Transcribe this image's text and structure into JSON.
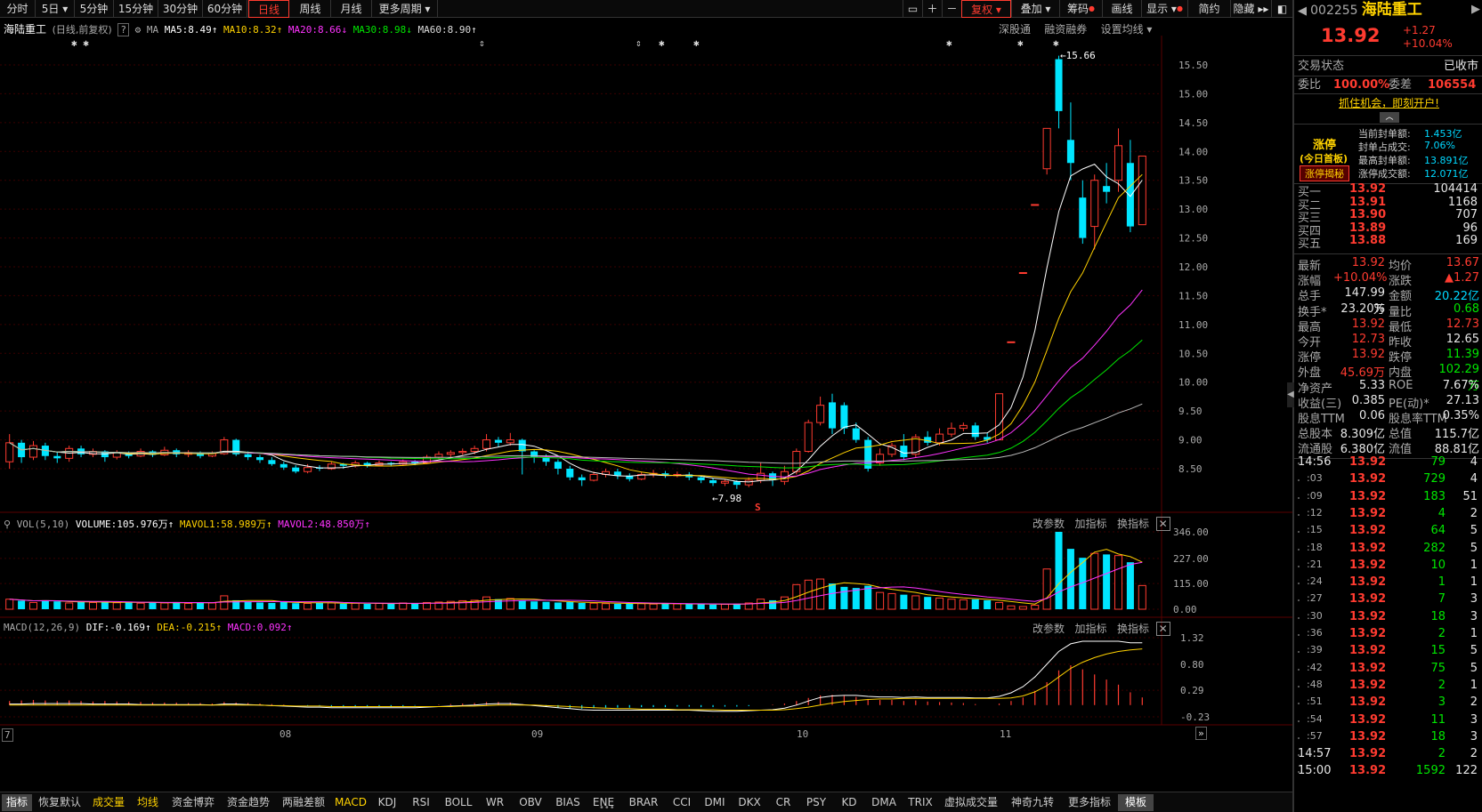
{
  "toolbar": {
    "periods": [
      "分时",
      "5日",
      "5分钟",
      "15分钟",
      "30分钟",
      "60分钟",
      "日线",
      "周线",
      "月线",
      "更多周期"
    ],
    "active_period": "日线",
    "tools": [
      "复权",
      "叠加",
      "筹码",
      "画线",
      "显示",
      "简约",
      "隐藏"
    ]
  },
  "stock": {
    "name": "海陆重工",
    "code": "002255",
    "mode": "(日线,前复权)",
    "price": "13.92",
    "change": "+1.27",
    "change_pct": "+10.04%"
  },
  "ma_legend": {
    "label": "MA",
    "ma5": "MA5:8.49",
    "ma10": "MA10:8.32",
    "ma20": "MA20:8.66",
    "ma30": "MA30:8.98",
    "ma60": "MA60:8.90"
  },
  "chart_links": [
    "深股通",
    "融资融券",
    "设置均线"
  ],
  "price_axis": [
    "15.50",
    "15.00",
    "14.50",
    "14.00",
    "13.50",
    "13.00",
    "12.50",
    "12.00",
    "11.50",
    "11.00",
    "10.50",
    "10.00",
    "9.50",
    "9.00",
    "8.50"
  ],
  "annotations": {
    "high": "15.66",
    "low": "7.98",
    "marker": "S"
  },
  "vol_legend": {
    "label": "VOL(5,10)",
    "volume": "VOLUME:105.976万",
    "mavol1": "MAVOL1:58.989万",
    "mavol2": "MAVOL2:48.850万"
  },
  "vol_axis": [
    "346.00",
    "227.00",
    "115.00",
    "0.00"
  ],
  "panel_links": [
    "改参数",
    "加指标",
    "换指标"
  ],
  "macd_legend": {
    "label": "MACD(12,26,9)",
    "dif": "DIF:-0.169",
    "dea": "DEA:-0.215",
    "macd": "MACD:0.092"
  },
  "macd_axis": [
    "1.32",
    "0.80",
    "0.29",
    "-0.23"
  ],
  "x_axis": [
    "7",
    "08",
    "09",
    "10",
    "11"
  ],
  "tabs": [
    "指标",
    "恢复默认",
    "成交量",
    "均线",
    "资金博弈",
    "资金趋势",
    "两融差额",
    "MACD",
    "KDJ",
    "RSI",
    "BOLL",
    "WR",
    "OBV",
    "BIAS",
    "ENE",
    "BRAR",
    "CCI",
    "DMI",
    "DKX",
    "CR",
    "PSY",
    "KD",
    "DMA",
    "TRIX",
    "虚拟成交量",
    "神奇九转",
    "更多指标",
    "模板"
  ],
  "panel": {
    "status_label": "交易状态",
    "status_value": "已收市",
    "webi_label": "委比",
    "webi_value": "100.00%",
    "wecha_label": "委差",
    "wecha_value": "106554",
    "promo": "抓住机会，即刻开户!",
    "limit_title": "涨停",
    "limit_sub": "(今日首板)",
    "limit_btn": "涨停揭秘",
    "limit_stats": [
      {
        "label": "当前封单额:",
        "value": "1.453亿"
      },
      {
        "label": "封单占成交:",
        "value": "7.06%"
      },
      {
        "label": "最高封单额:",
        "value": "13.891亿"
      },
      {
        "label": "涨停成交额:",
        "value": "12.071亿"
      }
    ],
    "bids": [
      {
        "label": "买一",
        "price": "13.92",
        "vol": "104414"
      },
      {
        "label": "买二",
        "price": "13.91",
        "vol": "1168"
      },
      {
        "label": "买三",
        "price": "13.90",
        "vol": "707"
      },
      {
        "label": "买四",
        "price": "13.89",
        "vol": "96"
      },
      {
        "label": "买五",
        "price": "13.88",
        "vol": "169"
      }
    ],
    "stats": [
      {
        "l1": "最新",
        "v1": "13.92",
        "c1": "red",
        "l2": "均价",
        "v2": "13.67",
        "c2": "red"
      },
      {
        "l1": "涨幅",
        "v1": "+10.04%",
        "c1": "red",
        "l2": "涨跌",
        "v2": "▲1.27",
        "c2": "red"
      },
      {
        "l1": "总手",
        "v1": "147.99万",
        "c1": "white",
        "l2": "金额",
        "v2": "20.22亿",
        "c2": "cyan"
      },
      {
        "l1": "换手*",
        "v1": "23.20%",
        "c1": "white",
        "l2": "量比",
        "v2": "0.68",
        "c2": "green"
      },
      {
        "l1": "最高",
        "v1": "13.92",
        "c1": "red",
        "l2": "最低",
        "v2": "12.73",
        "c2": "red"
      },
      {
        "l1": "今开",
        "v1": "12.73",
        "c1": "red",
        "l2": "昨收",
        "v2": "12.65",
        "c2": "white"
      },
      {
        "l1": "涨停",
        "v1": "13.92",
        "c1": "red",
        "l2": "跌停",
        "v2": "11.39",
        "c2": "green"
      },
      {
        "l1": "外盘",
        "v1": "45.69万",
        "c1": "red",
        "l2": "内盘",
        "v2": "102.29万",
        "c2": "green"
      },
      {
        "l1": "净资产",
        "v1": "5.33",
        "c1": "white",
        "l2": "ROE",
        "v2": "7.67%",
        "c2": "white"
      },
      {
        "l1": "收益(三)",
        "v1": "0.385",
        "c1": "white",
        "l2": "PE(动)*",
        "v2": "27.13",
        "c2": "white"
      },
      {
        "l1": "股息TTM",
        "v1": "0.06",
        "c1": "white",
        "l2": "股息率TTM",
        "v2": "0.35%",
        "c2": "white"
      },
      {
        "l1": "总股本",
        "v1": "8.309亿",
        "c1": "white",
        "l2": "总值",
        "v2": "115.7亿",
        "c2": "white"
      },
      {
        "l1": "流通股",
        "v1": "6.380亿",
        "c1": "white",
        "l2": "流值",
        "v2": "88.81亿",
        "c2": "white"
      }
    ],
    "ticks": [
      {
        "t": "14:56",
        "p": "13.92",
        "v": "79",
        "n": "4"
      },
      {
        "t": ":03",
        "p": "13.92",
        "v": "729",
        "n": "4"
      },
      {
        "t": ":09",
        "p": "13.92",
        "v": "183",
        "n": "51"
      },
      {
        "t": ":12",
        "p": "13.92",
        "v": "4",
        "n": "2"
      },
      {
        "t": ":15",
        "p": "13.92",
        "v": "64",
        "n": "5"
      },
      {
        "t": ":18",
        "p": "13.92",
        "v": "282",
        "n": "5"
      },
      {
        "t": ":21",
        "p": "13.92",
        "v": "10",
        "n": "1"
      },
      {
        "t": ":24",
        "p": "13.92",
        "v": "1",
        "n": "1"
      },
      {
        "t": ":27",
        "p": "13.92",
        "v": "7",
        "n": "3"
      },
      {
        "t": ":30",
        "p": "13.92",
        "v": "18",
        "n": "3"
      },
      {
        "t": ":36",
        "p": "13.92",
        "v": "2",
        "n": "1"
      },
      {
        "t": ":39",
        "p": "13.92",
        "v": "15",
        "n": "5"
      },
      {
        "t": ":42",
        "p": "13.92",
        "v": "75",
        "n": "5"
      },
      {
        "t": ":48",
        "p": "13.92",
        "v": "2",
        "n": "1"
      },
      {
        "t": ":51",
        "p": "13.92",
        "v": "3",
        "n": "2"
      },
      {
        "t": ":54",
        "p": "13.92",
        "v": "11",
        "n": "3"
      },
      {
        "t": ":57",
        "p": "13.92",
        "v": "18",
        "n": "3"
      },
      {
        "t": "14:57",
        "p": "13.92",
        "v": "2",
        "n": "2"
      },
      {
        "t": "15:00",
        "p": "13.92",
        "v": "1592",
        "n": "122"
      }
    ]
  },
  "chart_data": {
    "type": "candlestick",
    "price_range": [
      8.2,
      15.66
    ],
    "candles": [
      [
        8.62,
        8.95,
        9.1,
        8.5
      ],
      [
        8.95,
        8.7,
        9.0,
        8.6
      ],
      [
        8.7,
        8.9,
        8.98,
        8.65
      ],
      [
        8.9,
        8.72,
        8.95,
        8.65
      ],
      [
        8.72,
        8.68,
        8.8,
        8.6
      ],
      [
        8.68,
        8.85,
        8.9,
        8.62
      ],
      [
        8.85,
        8.75,
        8.9,
        8.7
      ],
      [
        8.75,
        8.8,
        8.85,
        8.7
      ],
      [
        8.8,
        8.7,
        8.82,
        8.62
      ],
      [
        8.7,
        8.78,
        8.82,
        8.66
      ],
      [
        8.78,
        8.72,
        8.8,
        8.68
      ],
      [
        8.72,
        8.8,
        8.85,
        8.7
      ],
      [
        8.8,
        8.74,
        8.82,
        8.7
      ],
      [
        8.74,
        8.82,
        8.88,
        8.72
      ],
      [
        8.82,
        8.75,
        8.85,
        8.7
      ],
      [
        8.75,
        8.78,
        8.82,
        8.7
      ],
      [
        8.78,
        8.72,
        8.8,
        8.68
      ],
      [
        8.72,
        8.76,
        8.8,
        8.7
      ],
      [
        8.76,
        9.0,
        9.05,
        8.74
      ],
      [
        9.0,
        8.75,
        9.02,
        8.72
      ],
      [
        8.75,
        8.7,
        8.8,
        8.65
      ],
      [
        8.7,
        8.65,
        8.74,
        8.6
      ],
      [
        8.65,
        8.58,
        8.7,
        8.55
      ],
      [
        8.58,
        8.52,
        8.62,
        8.48
      ],
      [
        8.52,
        8.45,
        8.56,
        8.42
      ],
      [
        8.45,
        8.52,
        8.58,
        8.42
      ],
      [
        8.52,
        8.5,
        8.56,
        8.46
      ],
      [
        8.5,
        8.58,
        8.62,
        8.48
      ],
      [
        8.58,
        8.55,
        8.6,
        8.5
      ],
      [
        8.55,
        8.6,
        8.64,
        8.52
      ],
      [
        8.6,
        8.56,
        8.62,
        8.52
      ],
      [
        8.56,
        8.6,
        8.64,
        8.54
      ],
      [
        8.6,
        8.58,
        8.62,
        8.54
      ],
      [
        8.58,
        8.62,
        8.66,
        8.55
      ],
      [
        8.62,
        8.6,
        8.65,
        8.56
      ],
      [
        8.6,
        8.7,
        8.74,
        8.58
      ],
      [
        8.7,
        8.75,
        8.8,
        8.66
      ],
      [
        8.75,
        8.78,
        8.82,
        8.7
      ],
      [
        8.78,
        8.8,
        8.85,
        8.74
      ],
      [
        8.8,
        8.85,
        8.9,
        8.75
      ],
      [
        8.85,
        9.0,
        9.1,
        8.8
      ],
      [
        9.0,
        8.95,
        9.05,
        8.88
      ],
      [
        8.95,
        9.0,
        9.12,
        8.9
      ],
      [
        9.0,
        8.8,
        9.02,
        8.4
      ],
      [
        8.8,
        8.7,
        8.82,
        8.6
      ],
      [
        8.7,
        8.62,
        8.75,
        8.55
      ],
      [
        8.62,
        8.5,
        8.66,
        8.4
      ],
      [
        8.5,
        8.35,
        8.55,
        8.3
      ],
      [
        8.35,
        8.3,
        8.4,
        8.2
      ],
      [
        8.3,
        8.4,
        8.45,
        8.28
      ],
      [
        8.4,
        8.45,
        8.5,
        8.35
      ],
      [
        8.45,
        8.38,
        8.5,
        8.32
      ],
      [
        8.38,
        8.32,
        8.42,
        8.28
      ],
      [
        8.32,
        8.4,
        8.45,
        8.3
      ],
      [
        8.4,
        8.42,
        8.48,
        8.35
      ],
      [
        8.42,
        8.38,
        8.46,
        8.34
      ],
      [
        8.38,
        8.4,
        8.45,
        8.35
      ],
      [
        8.4,
        8.35,
        8.44,
        8.3
      ],
      [
        8.35,
        8.3,
        8.38,
        8.25
      ],
      [
        8.3,
        8.25,
        8.34,
        8.2
      ],
      [
        8.25,
        8.28,
        8.32,
        8.2
      ],
      [
        8.28,
        8.22,
        8.3,
        8.15
      ],
      [
        8.22,
        8.3,
        8.35,
        8.18
      ],
      [
        8.3,
        8.42,
        8.6,
        8.25
      ],
      [
        8.42,
        8.3,
        8.45,
        8.2
      ],
      [
        8.28,
        8.45,
        8.55,
        8.22
      ],
      [
        8.45,
        8.8,
        8.85,
        8.4
      ],
      [
        8.8,
        9.3,
        9.35,
        8.78
      ],
      [
        9.3,
        9.6,
        9.75,
        9.25
      ],
      [
        9.65,
        9.2,
        9.8,
        9.1
      ],
      [
        9.6,
        9.2,
        9.65,
        9.1
      ],
      [
        9.2,
        9.0,
        9.3,
        8.95
      ],
      [
        9.0,
        8.5,
        9.05,
        8.45
      ],
      [
        8.6,
        8.75,
        8.85,
        8.55
      ],
      [
        8.75,
        8.9,
        8.95,
        8.7
      ],
      [
        8.9,
        8.7,
        9.1,
        8.65
      ],
      [
        8.75,
        9.05,
        9.1,
        8.7
      ],
      [
        9.05,
        8.95,
        9.15,
        8.9
      ],
      [
        8.95,
        9.1,
        9.2,
        8.9
      ],
      [
        9.1,
        9.2,
        9.3,
        9.05
      ],
      [
        9.2,
        9.25,
        9.3,
        9.15
      ],
      [
        9.25,
        9.05,
        9.3,
        9.0
      ],
      [
        9.05,
        9.0,
        9.12,
        8.95
      ],
      [
        9.0,
        9.8,
        9.8,
        9.0
      ],
      [
        10.7,
        10.7,
        10.7,
        10.7
      ],
      [
        11.9,
        11.9,
        11.9,
        11.9
      ],
      [
        13.08,
        13.08,
        13.08,
        13.08
      ],
      [
        13.7,
        14.4,
        14.4,
        13.6
      ],
      [
        15.6,
        14.7,
        15.66,
        14.4
      ],
      [
        14.2,
        13.8,
        14.85,
        13.5
      ],
      [
        13.2,
        12.5,
        13.5,
        12.4
      ],
      [
        12.7,
        13.5,
        13.6,
        12.3
      ],
      [
        13.4,
        13.3,
        13.8,
        13.1
      ],
      [
        13.5,
        14.1,
        14.4,
        13.3
      ],
      [
        13.8,
        12.7,
        14.2,
        12.6
      ],
      [
        12.73,
        13.92,
        13.92,
        12.73
      ]
    ],
    "volume_range": [
      0,
      346
    ],
    "volumes": [
      45,
      38,
      30,
      40,
      35,
      28,
      32,
      30,
      34,
      29,
      31,
      27,
      30,
      28,
      32,
      26,
      30,
      28,
      60,
      40,
      35,
      30,
      28,
      32,
      27,
      26,
      30,
      28,
      25,
      27,
      24,
      26,
      25,
      28,
      24,
      30,
      32,
      35,
      38,
      40,
      55,
      45,
      48,
      40,
      35,
      33,
      30,
      32,
      28,
      27,
      25,
      24,
      26,
      25,
      23,
      25,
      24,
      23,
      22,
      21,
      22,
      24,
      28,
      45,
      40,
      55,
      110,
      130,
      135,
      115,
      100,
      95,
      105,
      75,
      70,
      65,
      60,
      55,
      50,
      45,
      42,
      44,
      40,
      30,
      15,
      12,
      18,
      180,
      346,
      270,
      230,
      250,
      245,
      240,
      210,
      106
    ],
    "macd_range": [
      -0.23,
      1.32
    ],
    "macd_hist": [
      0.08,
      0.09,
      0.1,
      0.09,
      0.08,
      0.09,
      0.08,
      0.07,
      0.08,
      0.07,
      0.06,
      0.06,
      0.05,
      0.05,
      0.05,
      0.04,
      0.04,
      0.03,
      0.06,
      0.05,
      0.04,
      0.03,
      0.02,
      0.01,
      0.0,
      -0.01,
      -0.01,
      -0.02,
      -0.02,
      -0.02,
      -0.02,
      -0.02,
      -0.02,
      -0.02,
      -0.01,
      0.0,
      0.01,
      0.02,
      0.03,
      0.04,
      0.06,
      0.06,
      0.05,
      0.02,
      -0.01,
      -0.03,
      -0.05,
      -0.06,
      -0.07,
      -0.06,
      -0.05,
      -0.05,
      -0.05,
      -0.04,
      -0.04,
      -0.04,
      -0.03,
      -0.03,
      -0.04,
      -0.04,
      -0.03,
      -0.03,
      -0.02,
      0.0,
      0.01,
      0.03,
      0.08,
      0.14,
      0.19,
      0.2,
      0.18,
      0.16,
      0.12,
      0.1,
      0.1,
      0.08,
      0.09,
      0.07,
      0.06,
      0.05,
      0.04,
      0.02,
      0.0,
      0.03,
      0.08,
      0.15,
      0.28,
      0.45,
      0.68,
      0.78,
      0.7,
      0.6,
      0.5,
      0.4,
      0.25,
      0.15
    ],
    "dif": [
      0.02,
      0.02,
      0.03,
      0.03,
      0.03,
      0.03,
      0.03,
      0.02,
      0.02,
      0.02,
      0.02,
      0.01,
      0.01,
      0.01,
      0.01,
      0.01,
      0.01,
      0.0,
      0.02,
      0.02,
      0.01,
      0.0,
      -0.01,
      -0.02,
      -0.03,
      -0.04,
      -0.04,
      -0.05,
      -0.05,
      -0.05,
      -0.05,
      -0.05,
      -0.05,
      -0.05,
      -0.05,
      -0.04,
      -0.03,
      -0.02,
      -0.01,
      0.0,
      0.02,
      0.03,
      0.03,
      0.01,
      -0.01,
      -0.03,
      -0.05,
      -0.07,
      -0.09,
      -0.1,
      -0.1,
      -0.1,
      -0.1,
      -0.1,
      -0.1,
      -0.1,
      -0.1,
      -0.1,
      -0.11,
      -0.12,
      -0.12,
      -0.12,
      -0.11,
      -0.1,
      -0.09,
      -0.06,
      0.0,
      0.08,
      0.15,
      0.18,
      0.19,
      0.19,
      0.17,
      0.16,
      0.16,
      0.15,
      0.16,
      0.15,
      0.15,
      0.15,
      0.15,
      0.14,
      0.14,
      0.17,
      0.24,
      0.36,
      0.55,
      0.8,
      1.05,
      1.2,
      1.25,
      1.25,
      1.25,
      1.25,
      1.22,
      1.22
    ],
    "dea": [
      0.0,
      0.0,
      0.0,
      0.0,
      0.0,
      0.0,
      0.0,
      0.0,
      0.0,
      0.0,
      0.0,
      0.0,
      0.0,
      0.0,
      0.0,
      0.0,
      0.0,
      0.0,
      0.0,
      0.0,
      0.0,
      0.0,
      -0.01,
      -0.01,
      -0.02,
      -0.02,
      -0.02,
      -0.03,
      -0.03,
      -0.03,
      -0.03,
      -0.03,
      -0.03,
      -0.03,
      -0.03,
      -0.03,
      -0.03,
      -0.03,
      -0.02,
      -0.02,
      -0.01,
      0.0,
      0.0,
      0.0,
      0.0,
      -0.01,
      -0.02,
      -0.03,
      -0.04,
      -0.05,
      -0.06,
      -0.07,
      -0.07,
      -0.08,
      -0.08,
      -0.08,
      -0.09,
      -0.09,
      -0.09,
      -0.09,
      -0.1,
      -0.1,
      -0.1,
      -0.1,
      -0.1,
      -0.09,
      -0.07,
      -0.04,
      0.0,
      0.04,
      0.07,
      0.09,
      0.11,
      0.12,
      0.12,
      0.13,
      0.13,
      0.13,
      0.13,
      0.13,
      0.13,
      0.13,
      0.13,
      0.13,
      0.14,
      0.18,
      0.26,
      0.38,
      0.55,
      0.72,
      0.84,
      0.93,
      1.0,
      1.05,
      1.08,
      1.1
    ]
  }
}
